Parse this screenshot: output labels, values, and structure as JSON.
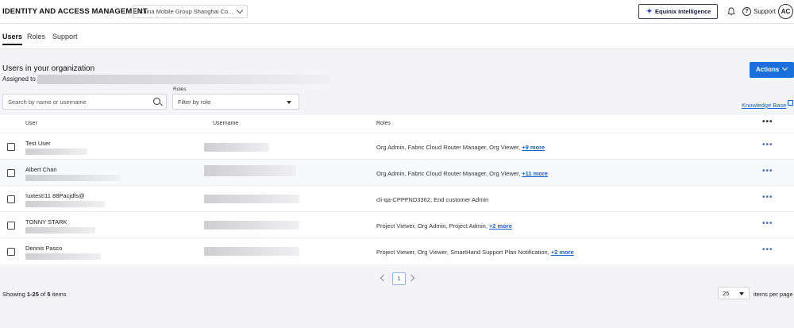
{
  "header": {
    "app_title": "IDENTITY AND ACCESS MANAGEMENT",
    "org_selector": "China Mobile Group Shanghai Co...",
    "intelligence_button": "Equinix Intelligence",
    "support_label": "Support",
    "avatar_initials": "AC"
  },
  "tabs": [
    {
      "label": "Users",
      "active": true
    },
    {
      "label": "Roles",
      "active": false
    },
    {
      "label": "Support",
      "active": false
    }
  ],
  "main": {
    "title": "Users in your organization",
    "assigned_label": "Assigned to",
    "actions_button": "Actions"
  },
  "filters": {
    "search_placeholder": "Search by name or username",
    "roles_label": "Roles",
    "roles_placeholder": "Filter by role",
    "knowledge_base_link": "Knowledge Base"
  },
  "table": {
    "columns": {
      "user": "User",
      "username": "Username",
      "roles": "Roles",
      "more": "•••"
    },
    "rows": [
      {
        "user": "Test User",
        "roles": "Org Admin, Fabric Cloud Router Manager, Org Viewer,",
        "more_roles": "+9 more"
      },
      {
        "user": "Albert Chan",
        "roles": "Org Admin, Fabric Cloud Router Manager, Org Viewer,",
        "more_roles": "+11 more"
      },
      {
        "user": "!uxtest!11 88Pacjdfs@",
        "roles": "cli-qa-CPPFND3362, End customer Admin",
        "more_roles": ""
      },
      {
        "user": "TONNY STARK",
        "roles": "Project Viewer, Org Admin, Project Admin,",
        "more_roles": "+2 more"
      },
      {
        "user": "Dennis Pasco",
        "roles": "Project Viewer, Org Viewer, SmartHand Support Plan Notification,",
        "more_roles": "+2 more"
      }
    ],
    "row_menu": "•••"
  },
  "pagination": {
    "current_page": "1",
    "showing_prefix": "Showing",
    "showing_range": "1-25",
    "showing_of": "of",
    "showing_total": "5",
    "showing_suffix": "items",
    "per_page_value": "25",
    "per_page_label": "items per page"
  }
}
